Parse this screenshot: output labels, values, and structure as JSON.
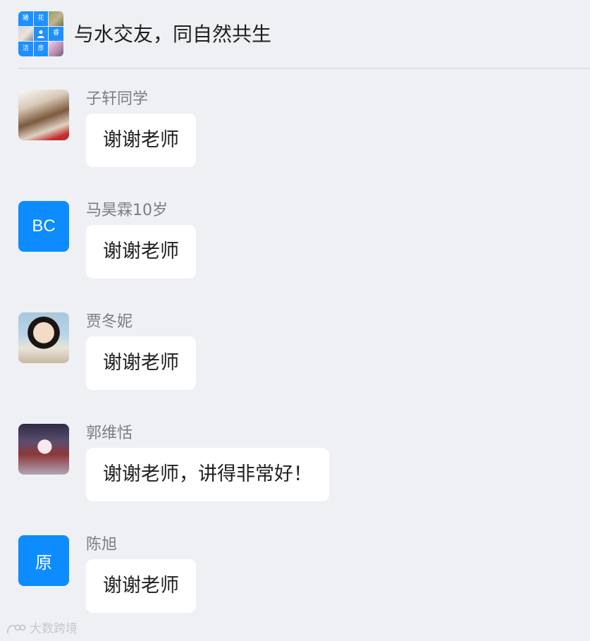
{
  "group": {
    "title": "与水交友，同自然共生",
    "avatar_tiles": [
      "猪",
      "花",
      "睿",
      "洁",
      "彦"
    ]
  },
  "messages": [
    {
      "sender": "子轩同学",
      "text": "谢谢老师",
      "avatar_type": "photo",
      "avatar_text": ""
    },
    {
      "sender": "马昊霖10岁",
      "text": "谢谢老师",
      "avatar_type": "text",
      "avatar_text": "BC"
    },
    {
      "sender": "贾冬妮",
      "text": "谢谢老师",
      "avatar_type": "photo",
      "avatar_text": ""
    },
    {
      "sender": "郭维恬",
      "text": "谢谢老师，讲得非常好！",
      "avatar_type": "photo",
      "avatar_text": ""
    },
    {
      "sender": "陈旭",
      "text": "谢谢老师",
      "avatar_type": "text",
      "avatar_text": "原"
    }
  ],
  "watermark": {
    "text": "大数跨境"
  },
  "colors": {
    "background": "#eff0f4",
    "bubble": "#ffffff",
    "avatar_blue": "#0d8cff",
    "sender_name": "#7b7d82"
  }
}
